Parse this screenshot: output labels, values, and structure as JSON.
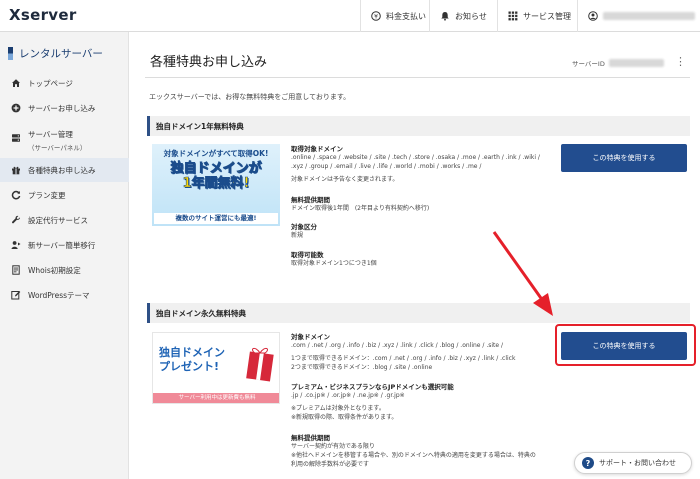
{
  "app": {
    "logo": "Xserver"
  },
  "topnav": {
    "payment": "料金支払い",
    "notices": "お知らせ",
    "service_mgmt": "サービス管理"
  },
  "sidebar": {
    "title": "レンタルサーバー",
    "items": [
      {
        "label": "トップページ",
        "icon": "home-icon"
      },
      {
        "label": "サーバーお申し込み",
        "icon": "plus-circle-icon"
      },
      {
        "label": "サーバー管理",
        "sub": "（サーバーパネル）",
        "icon": "server-icon"
      },
      {
        "label": "各種特典お申し込み",
        "icon": "gift-icon",
        "active": true
      },
      {
        "label": "プラン変更",
        "icon": "refresh-icon"
      },
      {
        "label": "設定代行サービス",
        "icon": "wrench-icon"
      },
      {
        "label": "新サーバー簡単移行",
        "icon": "user-move-icon"
      },
      {
        "label": "Whois初期設定",
        "icon": "document-icon"
      },
      {
        "label": "WordPressテーマ",
        "icon": "edit-icon"
      }
    ]
  },
  "main": {
    "title": "各種特典お申し込み",
    "server_id_label": "サーバーID",
    "intro": "エックスサーバーでは、お得な無料特典をご用意しております。",
    "sections": [
      {
        "heading": "独自ドメイン1年無料特典",
        "banner": {
          "top": "対象ドメインがすべて取得OK!",
          "line1": "独自ドメインが",
          "line2": "1年間無料!",
          "foot": "複数のサイト運営にも最適!"
        },
        "domains_label": "取得対象ドメイン",
        "domains_1": ".online / .space / .website / .site / .tech / .store / .osaka / .moe / .earth / .ink / .wiki /",
        "domains_2": ".xyz / .group / .email / .live / .life / .world / .mobi / .works / .me /",
        "domains_note": "対象ドメインは予告なく変更されます。",
        "period_label": "無料提供期間",
        "period_text": "ドメイン取得後1年間　(2年目より有料契約へ移行)",
        "type_label": "対象区分",
        "type_text": "新規",
        "count_label": "取得可能数",
        "count_text": "取得対象ドメイン1つにつき1個",
        "button": "この特典を使用する"
      },
      {
        "heading": "独自ドメイン永久無料特典",
        "banner": {
          "line1": "独自ドメイン",
          "line2": "プレゼント!",
          "foot": "サーバー利用中は更新費も無料"
        },
        "domains_label": "対象ドメイン",
        "domains_1": ".com / .net / .org / .info / .biz / .xyz / .link / .click / .blog / .online / .site /",
        "domains_2": "1つまで取得できるドメイン：.com / .net / .org / .info / .biz / .xyz / .link / .click",
        "domains_3": "2つまで取得できるドメイン：.blog / .site / .online",
        "premium_label": "プレミアム・ビジネスプランならJPドメインも選択可能",
        "premium_text": ".jp / .co.jp※ / .or.jp※ / .ne.jp※ / .gr.jp※",
        "premium_note_1": "※プレミアムは対象外となります。",
        "premium_note_2": "※新規取得の際、取得条件があります。",
        "period_label": "無料提供期間",
        "period_text_1": "サーバー契約が有効である限り",
        "period_text_2": "※他社へドメインを移管する場合や、別のドメインへ特典の適用を変更する場合は、特典の",
        "period_text_3": "利用の解除手数料が必要です",
        "button": "この特典を使用する"
      }
    ]
  },
  "support": {
    "label": "サポート・お問い合わせ"
  },
  "colors": {
    "accent": "#224d8f",
    "annotation": "#e5202a"
  }
}
